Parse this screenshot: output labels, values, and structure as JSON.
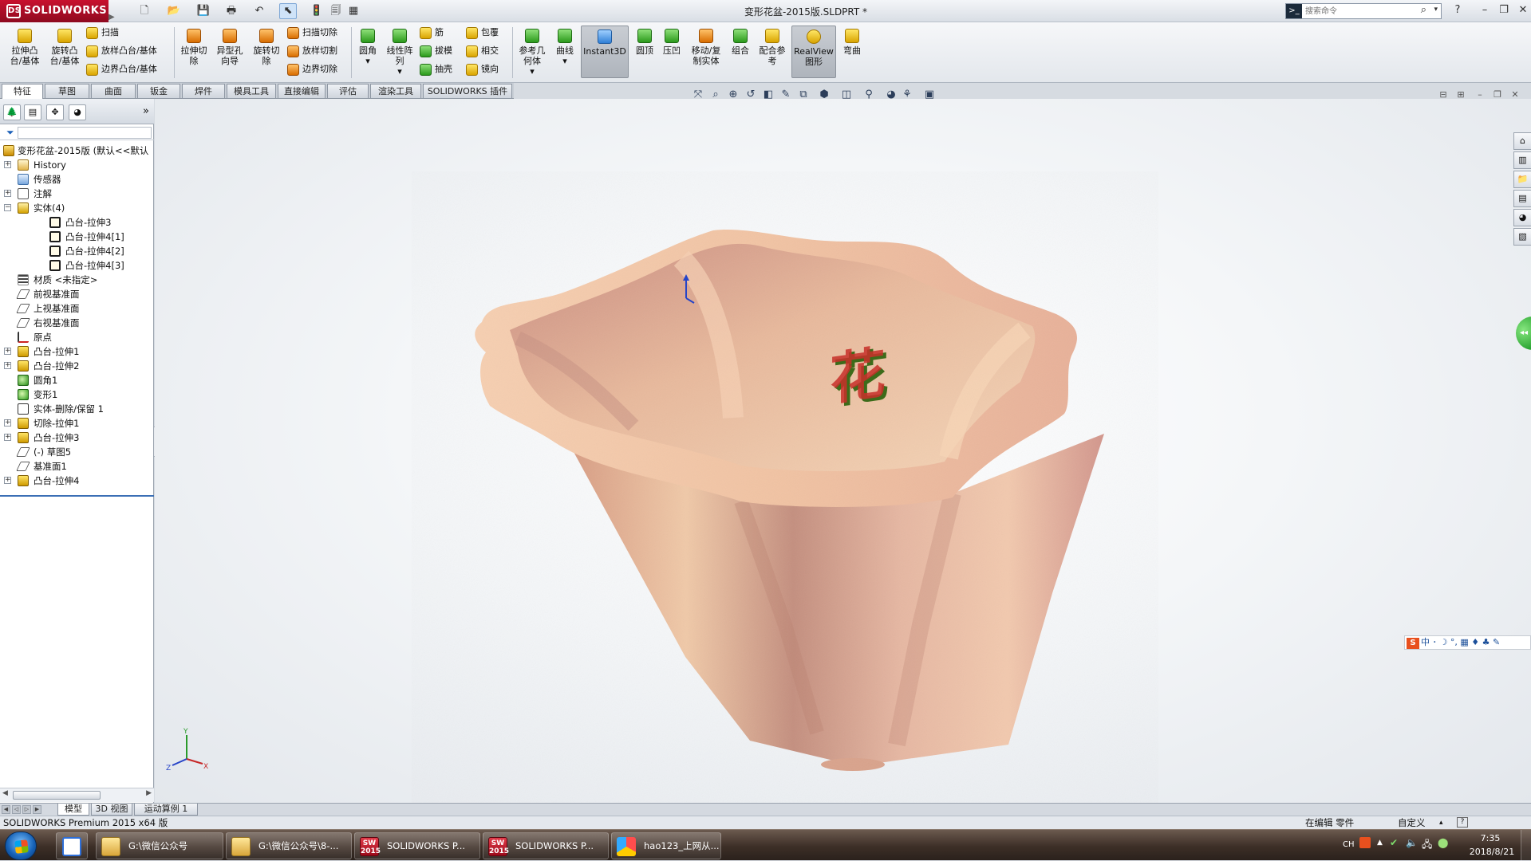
{
  "app": {
    "brand": "SOLIDWORKS",
    "ds_mark": "DS",
    "doc_title": "变形花盆-2015版.SLDPRT *"
  },
  "quick_access": [
    "new-icon",
    "open-icon",
    "save-icon",
    "print-icon",
    "undo-icon",
    "select-icon",
    "rebuild-icon",
    "file-properties-icon",
    "options-icon"
  ],
  "search": {
    "placeholder": "搜索命令"
  },
  "ribbon": {
    "extrude_boss": "拉伸凸\n台/基体",
    "revolve_boss": "旋转凸\n台/基体",
    "sweep": "扫描",
    "loft_boss": "放样凸台/基体",
    "boundary_boss": "边界凸台/基体",
    "extrude_cut": "拉伸切\n除",
    "hole_wizard": "异型孔\n向导",
    "revolve_cut": "旋转切\n除",
    "sweep_cut": "扫描切除",
    "loft_cut": "放样切割",
    "boundary_cut": "边界切除",
    "fillet": "圆角",
    "linear_pattern": "线性阵\n列",
    "rib": "筋",
    "draft": "拔模",
    "shell": "抽壳",
    "wrap": "包覆",
    "intersect": "相交",
    "mirror": "镜向",
    "ref_geometry": "参考几\n何体",
    "curves": "曲线",
    "instant3d": "Instant3D",
    "dome": "圆顶",
    "indent": "压凹",
    "move_copy": "移动/复\n制实体",
    "combine": "组合",
    "mate_ref": "配合参\n考",
    "realview": "RealView\n图形",
    "flex": "弯曲"
  },
  "tabs": [
    "特征",
    "草图",
    "曲面",
    "钣金",
    "焊件",
    "模具工具",
    "直接编辑",
    "评估",
    "渲染工具",
    "SOLIDWORKS 插件"
  ],
  "tree": {
    "root": "变形花盆-2015版 (默认<<默认",
    "items": [
      {
        "label": "History",
        "level": 1,
        "exp": "+",
        "icon": "i-hist",
        "name": "history-icon"
      },
      {
        "label": "传感器",
        "level": 1,
        "exp": "",
        "icon": "i-sens",
        "name": "sensors-icon"
      },
      {
        "label": "注解",
        "level": 1,
        "exp": "+",
        "icon": "i-ann",
        "name": "annotations-icon"
      },
      {
        "label": "实体(4)",
        "level": 1,
        "exp": "−",
        "icon": "i-body",
        "name": "solid-bodies-icon"
      },
      {
        "label": "凸台-拉伸3",
        "level": 2,
        "exp": "",
        "icon": "i-bodyitem",
        "name": "body-icon"
      },
      {
        "label": "凸台-拉伸4[1]",
        "level": 2,
        "exp": "",
        "icon": "i-bodyitem",
        "name": "body-icon"
      },
      {
        "label": "凸台-拉伸4[2]",
        "level": 2,
        "exp": "",
        "icon": "i-bodyitem",
        "name": "body-icon"
      },
      {
        "label": "凸台-拉伸4[3]",
        "level": 2,
        "exp": "",
        "icon": "i-bodyitem",
        "name": "body-icon"
      },
      {
        "label": "材质 <未指定>",
        "level": 1,
        "exp": "",
        "icon": "i-mat",
        "name": "material-icon"
      },
      {
        "label": "前视基准面",
        "level": 1,
        "exp": "",
        "icon": "i-plane",
        "name": "plane-icon"
      },
      {
        "label": "上视基准面",
        "level": 1,
        "exp": "",
        "icon": "i-plane",
        "name": "plane-icon"
      },
      {
        "label": "右视基准面",
        "level": 1,
        "exp": "",
        "icon": "i-plane",
        "name": "plane-icon"
      },
      {
        "label": "原点",
        "level": 1,
        "exp": "",
        "icon": "i-orig",
        "name": "origin-icon"
      },
      {
        "label": "凸台-拉伸1",
        "level": 1,
        "exp": "+",
        "icon": "i-ext",
        "name": "boss-extrude-icon"
      },
      {
        "label": "凸台-拉伸2",
        "level": 1,
        "exp": "+",
        "icon": "i-ext",
        "name": "boss-extrude-icon"
      },
      {
        "label": "圆角1",
        "level": 1,
        "exp": "",
        "icon": "i-fil",
        "name": "fillet-icon"
      },
      {
        "label": "变形1",
        "level": 1,
        "exp": "",
        "icon": "i-flex",
        "name": "deform-icon"
      },
      {
        "label": "实体-删除/保留 1",
        "level": 1,
        "exp": "",
        "icon": "i-del",
        "name": "delete-body-icon"
      },
      {
        "label": "切除-拉伸1",
        "level": 1,
        "exp": "+",
        "icon": "i-ext",
        "name": "cut-extrude-icon"
      },
      {
        "label": "凸台-拉伸3",
        "level": 1,
        "exp": "+",
        "icon": "i-ext",
        "name": "boss-extrude-icon"
      },
      {
        "label": "(-) 草图5",
        "level": 1,
        "exp": "",
        "icon": "i-sk",
        "name": "sketch-icon"
      },
      {
        "label": "基准面1",
        "level": 1,
        "exp": "",
        "icon": "i-plane",
        "name": "plane-icon"
      },
      {
        "label": "凸台-拉伸4",
        "level": 1,
        "exp": "+",
        "icon": "i-ext",
        "name": "boss-extrude-icon"
      }
    ]
  },
  "model_glyph": "花",
  "triad": {
    "x": "X",
    "y": "Y",
    "z": "Z"
  },
  "ime": {
    "s": "S",
    "text": "中 ･ ☽ °, ▦ ♦ ♣ ✎"
  },
  "bottom_tabs": [
    "模型",
    "3D 视图",
    "运动算例 1"
  ],
  "status": {
    "left": "SOLIDWORKS Premium 2015 x64 版",
    "editing": "在编辑 零件",
    "custom": "自定义"
  },
  "taskbar": {
    "items": [
      {
        "label": "G:\\微信公众号",
        "icon": "ti-folder"
      },
      {
        "label": "G:\\微信公众号\\8-...",
        "icon": "ti-folder"
      },
      {
        "label": "SOLIDWORKS P...",
        "icon": "ti-sw"
      },
      {
        "label": "SOLIDWORKS P...",
        "icon": "ti-sw"
      },
      {
        "label": "hao123_上网从...",
        "icon": "ti-hao"
      }
    ],
    "sw_badge": "SW\n2015",
    "lang": "CH",
    "time": "7:35",
    "date": "2018/8/21"
  },
  "colors": {
    "accent": "#c8102e",
    "pot_highlight": "#f6d3b0",
    "pot_mid": "#e6a98a",
    "pot_shadow": "#c58872",
    "glyph_red": "#c8302a",
    "glyph_green": "#5aa02a",
    "glyph_yellow": "#e8c51a"
  }
}
